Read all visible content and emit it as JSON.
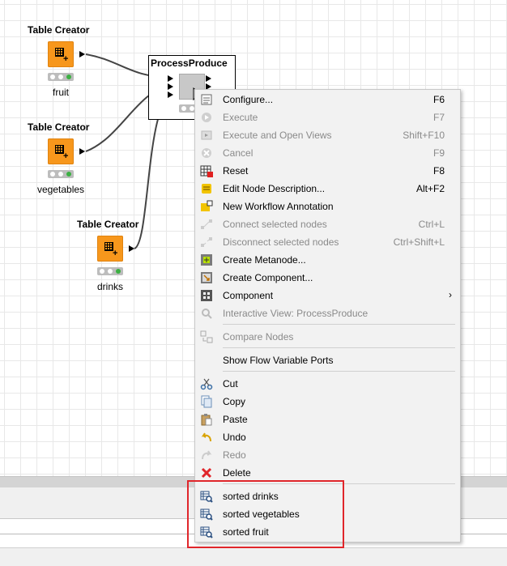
{
  "nodes": [
    {
      "title": "Table Creator",
      "label": "fruit"
    },
    {
      "title": "Table Creator",
      "label": "vegetables"
    },
    {
      "title": "Table Creator",
      "label": "drinks"
    }
  ],
  "process_node": {
    "title": "ProcessProduce"
  },
  "menu": {
    "items": [
      {
        "label": "Configure...",
        "shortcut": "F6",
        "icon": "configure-icon",
        "enabled": true
      },
      {
        "label": "Execute",
        "shortcut": "F7",
        "icon": "execute-icon",
        "enabled": false
      },
      {
        "label": "Execute and Open Views",
        "shortcut": "Shift+F10",
        "icon": "execute-open-views-icon",
        "enabled": false
      },
      {
        "label": "Cancel",
        "shortcut": "F9",
        "icon": "cancel-icon",
        "enabled": false
      },
      {
        "label": "Reset",
        "shortcut": "F8",
        "icon": "reset-icon",
        "enabled": true
      },
      {
        "label": "Edit Node Description...",
        "shortcut": "Alt+F2",
        "icon": "edit-description-icon",
        "enabled": true
      },
      {
        "label": "New Workflow Annotation",
        "shortcut": "",
        "icon": "annotation-icon",
        "enabled": true
      },
      {
        "label": "Connect selected nodes",
        "shortcut": "Ctrl+L",
        "icon": "connect-nodes-icon",
        "enabled": false
      },
      {
        "label": "Disconnect selected nodes",
        "shortcut": "Ctrl+Shift+L",
        "icon": "disconnect-nodes-icon",
        "enabled": false
      },
      {
        "label": "Create Metanode...",
        "shortcut": "",
        "icon": "metanode-icon",
        "enabled": true
      },
      {
        "label": "Create Component...",
        "shortcut": "",
        "icon": "component-create-icon",
        "enabled": true
      },
      {
        "label": "Component",
        "shortcut": "",
        "icon": "component-icon",
        "enabled": true,
        "submenu": true
      },
      {
        "label": "Interactive View: ProcessProduce",
        "shortcut": "",
        "icon": "magnifier-icon",
        "enabled": false
      },
      {
        "label": "Compare Nodes",
        "shortcut": "",
        "icon": "compare-nodes-icon",
        "enabled": false
      },
      {
        "label": "Show Flow Variable Ports",
        "shortcut": "",
        "icon": "",
        "enabled": true
      },
      {
        "label": "Cut",
        "shortcut": "",
        "icon": "cut-icon",
        "enabled": true
      },
      {
        "label": "Copy",
        "shortcut": "",
        "icon": "copy-icon",
        "enabled": true
      },
      {
        "label": "Paste",
        "shortcut": "",
        "icon": "paste-icon",
        "enabled": true
      },
      {
        "label": "Undo",
        "shortcut": "",
        "icon": "undo-icon",
        "enabled": true
      },
      {
        "label": "Redo",
        "shortcut": "",
        "icon": "redo-icon",
        "enabled": false
      },
      {
        "label": "Delete",
        "shortcut": "",
        "icon": "delete-icon",
        "enabled": true
      },
      {
        "label": "sorted drinks",
        "shortcut": "",
        "icon": "port-view-icon",
        "enabled": true
      },
      {
        "label": "sorted vegetables",
        "shortcut": "",
        "icon": "port-view-icon",
        "enabled": true
      },
      {
        "label": "sorted fruit",
        "shortcut": "",
        "icon": "port-view-icon",
        "enabled": true
      }
    ]
  },
  "colors": {
    "node_orange": "#f7971c",
    "highlight_red": "#e0262b",
    "status_green": "#3cb043"
  }
}
